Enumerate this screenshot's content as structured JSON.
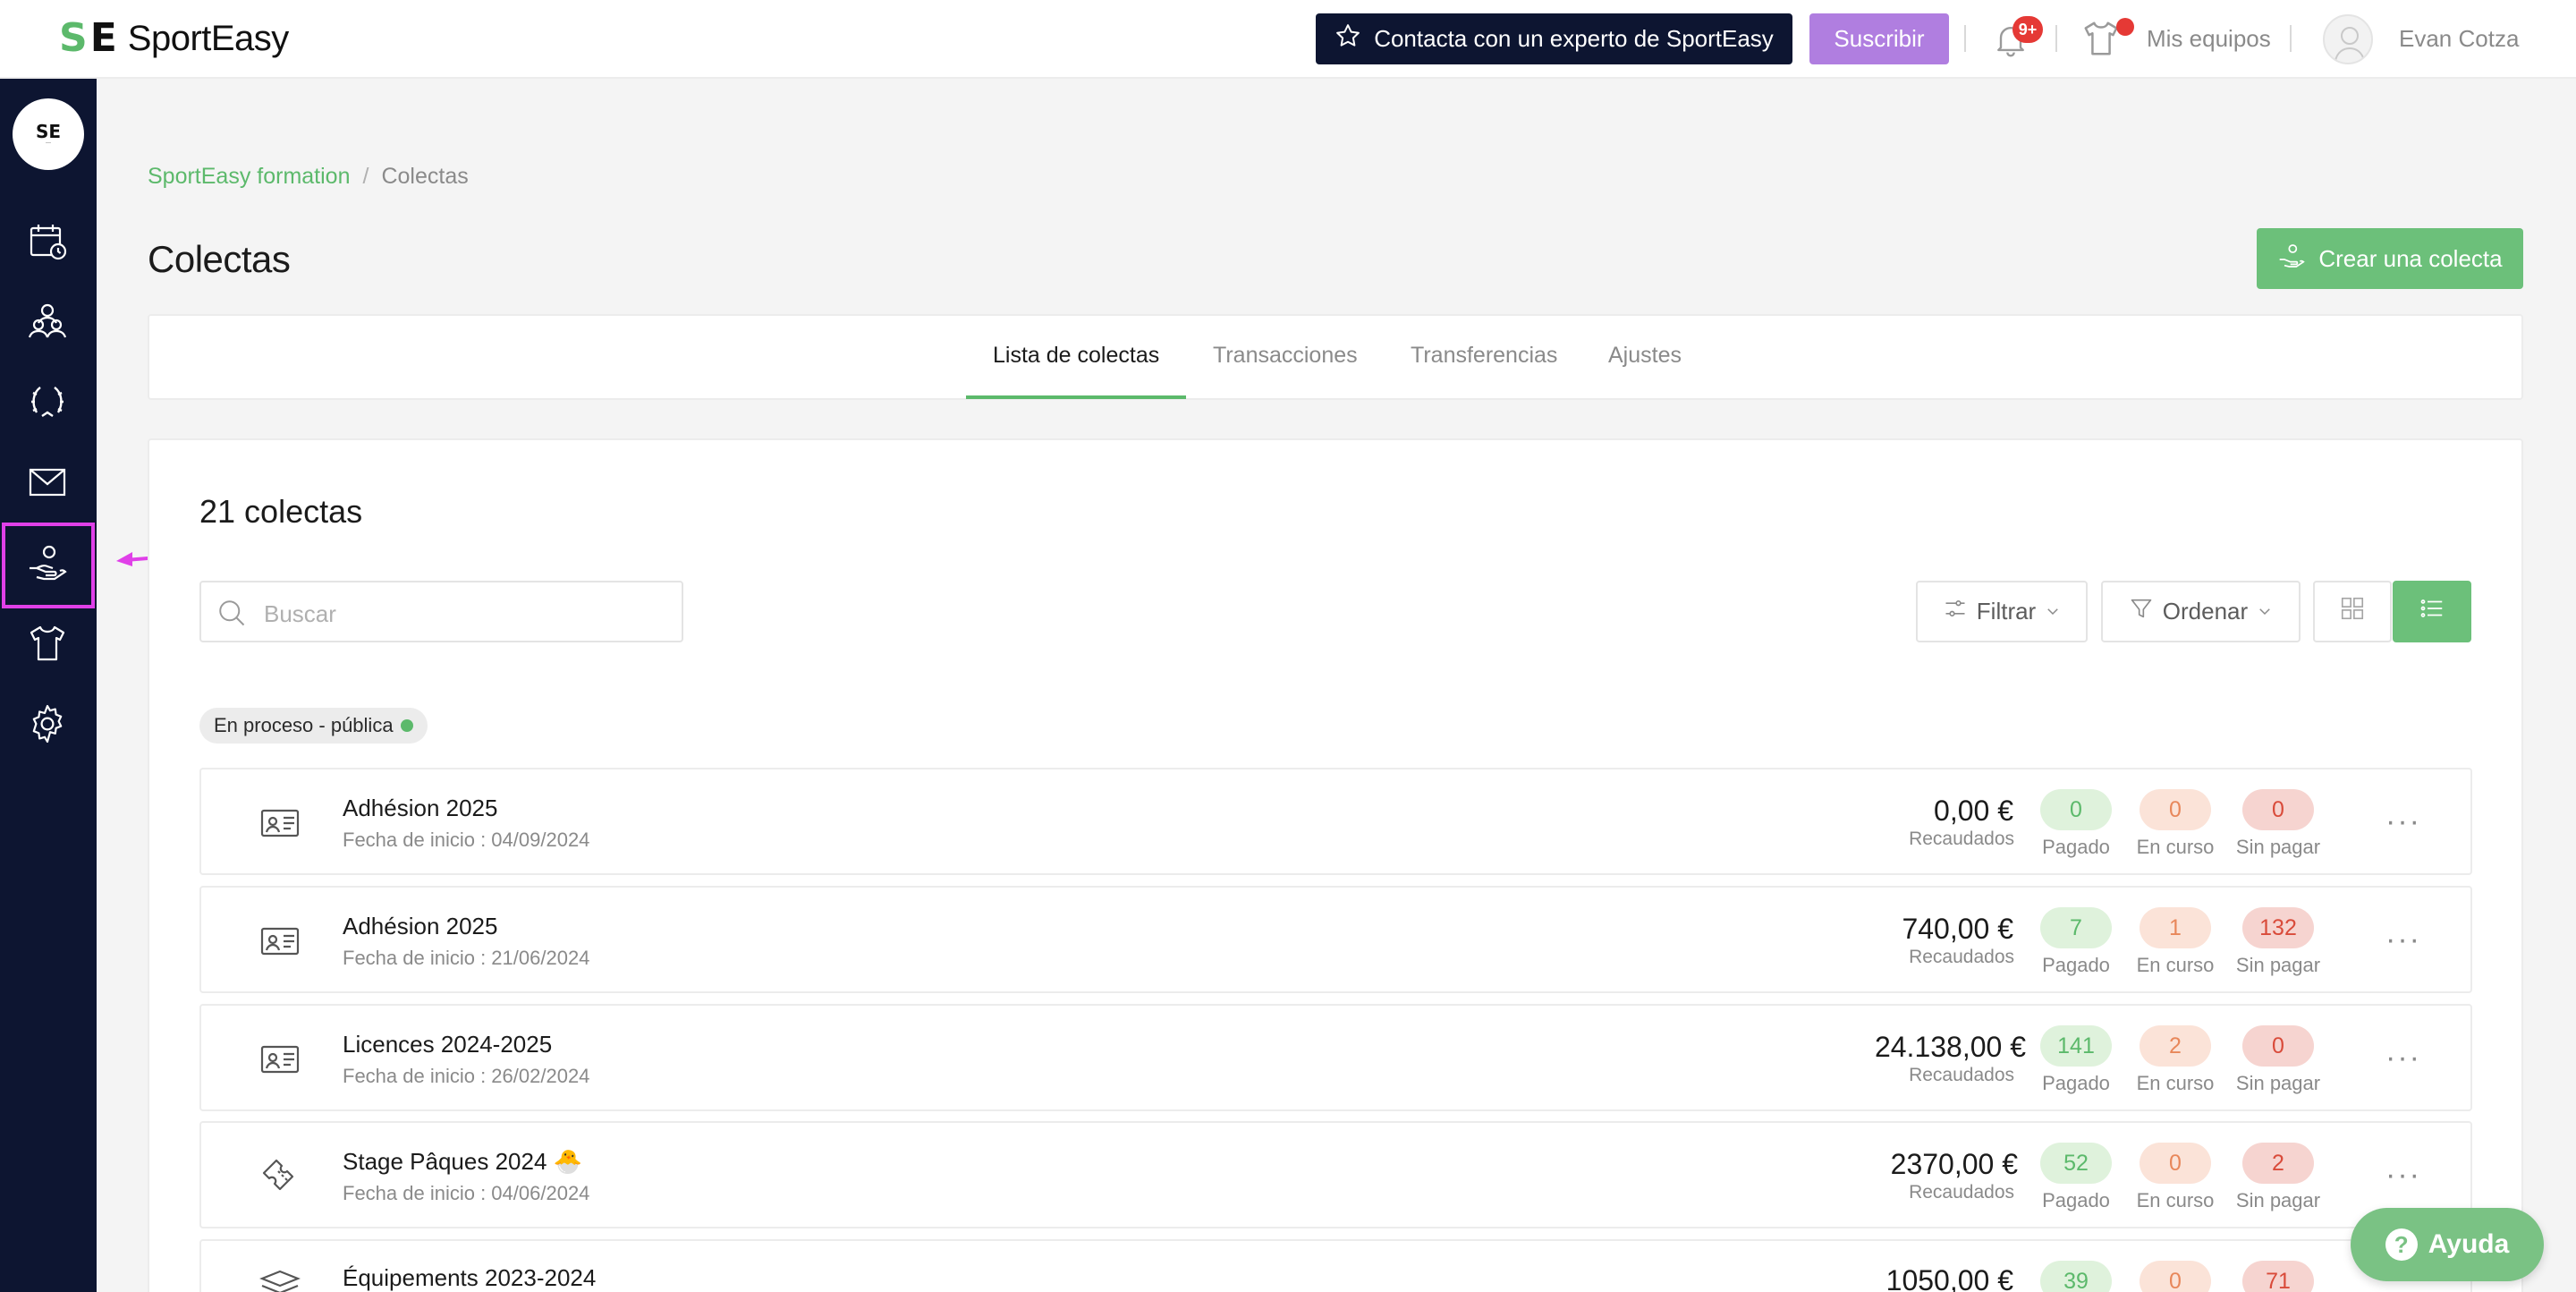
{
  "brand": {
    "name": "SportEasy",
    "mark_s": "S",
    "mark_e": "E",
    "accent": "#5cb96b",
    "navy": "#0d1531"
  },
  "topbar": {
    "expert_label": "Contacta con un experto de SportEasy",
    "subscribe_label": "Suscribir",
    "notifications_badge": "9+",
    "my_teams_label": "Mis equipos",
    "user_name": "Evan Cotza"
  },
  "sidebar": {
    "team_logo_text": "SE",
    "items": [
      {
        "name": "calendar",
        "icon": "calendar-clock-icon"
      },
      {
        "name": "members",
        "icon": "users-icon"
      },
      {
        "name": "competitions",
        "icon": "laurel-icon"
      },
      {
        "name": "messages",
        "icon": "envelope-icon"
      },
      {
        "name": "collections",
        "icon": "hand-coin-icon",
        "active": true
      },
      {
        "name": "equipment",
        "icon": "shirt-icon"
      },
      {
        "name": "settings",
        "icon": "gear-icon"
      }
    ]
  },
  "breadcrumb": {
    "root": "SportEasy formation",
    "separator": "/",
    "current": "Colectas"
  },
  "page": {
    "title": "Colectas",
    "create_label": "Crear una colecta"
  },
  "tabs": [
    {
      "label": "Lista de colectas",
      "active": true
    },
    {
      "label": "Transacciones"
    },
    {
      "label": "Transferencias"
    },
    {
      "label": "Ajustes"
    }
  ],
  "list": {
    "count_label": "21 colectas",
    "search_placeholder": "Buscar",
    "filter_label": "Filtrar",
    "sort_label": "Ordenar",
    "status_chip": "En proceso - pública",
    "status_labels": {
      "paid": "Pagado",
      "pending": "En curso",
      "unpaid": "Sin pagar"
    },
    "amount_label": "Recaudados",
    "rows": [
      {
        "icon": "id-card-icon",
        "title": "Adhésion 2025",
        "subtitle": "Fecha de inicio : 04/09/2024",
        "amount": "0,00 €",
        "paid": "0",
        "pending": "0",
        "unpaid": "0"
      },
      {
        "icon": "id-card-icon",
        "title": "Adhésion 2025",
        "subtitle": "Fecha de inicio : 21/06/2024",
        "amount": "740,00 €",
        "paid": "7",
        "pending": "1",
        "unpaid": "132"
      },
      {
        "icon": "id-card-icon",
        "title": "Licences 2024-2025",
        "subtitle": "Fecha de inicio : 26/02/2024",
        "amount": "24.138,00 €",
        "paid": "141",
        "pending": "2",
        "unpaid": "0"
      },
      {
        "icon": "ticket-icon",
        "title": "Stage Pâques 2024 🐣",
        "subtitle": "Fecha de inicio : 04/06/2024",
        "amount": "2370,00 €",
        "paid": "52",
        "pending": "0",
        "unpaid": "2"
      },
      {
        "icon": "stack-icon",
        "title": "Équipements 2023-2024",
        "subtitle": "",
        "amount": "1050,00 €",
        "paid": "39",
        "pending": "0",
        "unpaid": "71"
      }
    ]
  },
  "help": {
    "label": "Ayuda",
    "glyph": "?"
  }
}
